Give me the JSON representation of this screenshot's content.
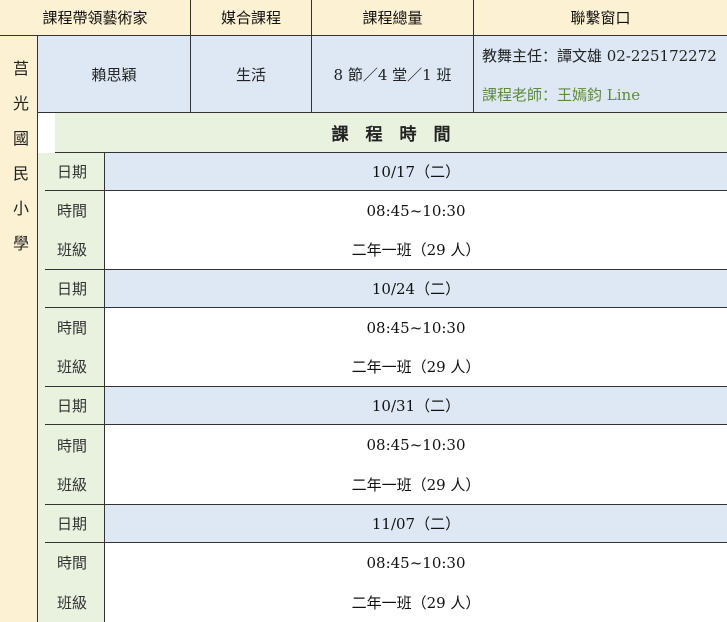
{
  "header": {
    "artist_label": "課程帶領藝術家",
    "course_label": "媒合課程",
    "total_label": "課程總量",
    "contact_label": "聯繫窗口"
  },
  "info": {
    "school": "莒光國民小學",
    "artist": "賴思穎",
    "course": "生活",
    "total": "8 節／4 堂／1 班",
    "contact_director": "教舞主任：譚文雄 02-225172272",
    "contact_teacher": "課程老師：王嫣鈞 Line"
  },
  "schedule": {
    "title": "課　程　時　間",
    "labels": {
      "date": "日期",
      "time": "時間",
      "class": "班級"
    },
    "sessions": [
      {
        "date": "10/17（二）",
        "time": "08:45~10:30",
        "class": "二年一班（29 人）"
      },
      {
        "date": "10/24（二）",
        "time": "08:45~10:30",
        "class": "二年一班（29 人）"
      },
      {
        "date": "10/31（二）",
        "time": "08:45~10:30",
        "class": "二年一班（29 人）"
      },
      {
        "date": "11/07（二）",
        "time": "08:45~10:30",
        "class": "二年一班（29 人）"
      }
    ]
  },
  "colors": {
    "cream": "#fcf1d2",
    "light_blue": "#dde8f4",
    "light_green": "#e9f1df",
    "contact_green_text": "#5f8a3c"
  }
}
